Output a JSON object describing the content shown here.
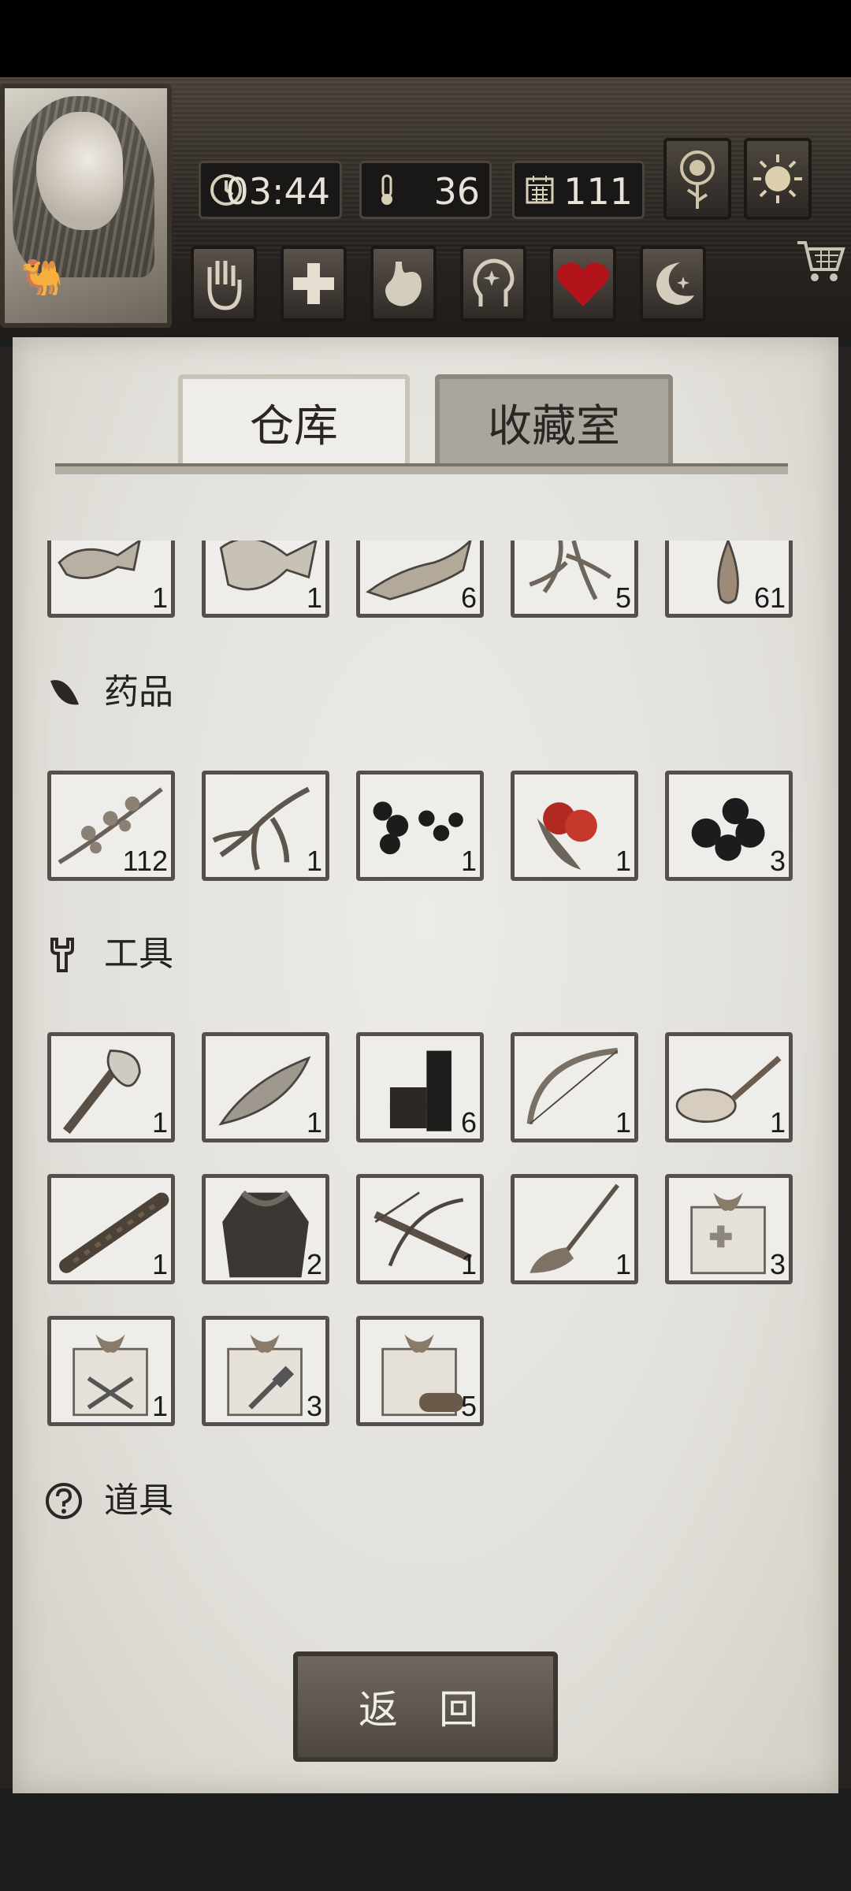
{
  "hud": {
    "time": "03:44",
    "temperature": "36",
    "days": "111",
    "stats_icons": [
      "clock-icon",
      "thermometer-icon",
      "calendar-icon"
    ],
    "status_icons": [
      "hand-icon",
      "cross-icon",
      "stomach-icon",
      "mind-icon",
      "heart-icon",
      "moon-icon"
    ],
    "top_right_icons": [
      "sunflower-icon",
      "sun-icon",
      "cart-icon"
    ],
    "heart_color": "#b3141b"
  },
  "tabs": {
    "warehouse": "仓库",
    "collection": "收藏室",
    "active": "warehouse"
  },
  "partial_row": [
    {
      "name": "fish-item",
      "qty": "1"
    },
    {
      "name": "flatfish-item",
      "qty": "1"
    },
    {
      "name": "eel-fish-item",
      "qty": "6"
    },
    {
      "name": "root-item",
      "qty": "5"
    },
    {
      "name": "drop-item",
      "qty": "61"
    }
  ],
  "sections": {
    "medicine": {
      "title": "药品",
      "items": [
        {
          "name": "herb-branch-item",
          "qty": "112"
        },
        {
          "name": "ginseng-item",
          "qty": "1"
        },
        {
          "name": "black-pills-item",
          "qty": "1"
        },
        {
          "name": "red-berries-item",
          "qty": "1"
        },
        {
          "name": "dark-berries-item",
          "qty": "3"
        }
      ]
    },
    "tools": {
      "title": "工具",
      "items": [
        {
          "name": "stone-axe-item",
          "qty": "1"
        },
        {
          "name": "stone-blade-item",
          "qty": "1"
        },
        {
          "name": "firecracker-item",
          "qty": "6"
        },
        {
          "name": "bow-item",
          "qty": "1"
        },
        {
          "name": "wooden-spoon-item",
          "qty": "1"
        },
        {
          "name": "torch-item",
          "qty": "1"
        },
        {
          "name": "fur-coat-item",
          "qty": "2"
        },
        {
          "name": "crossbow-item",
          "qty": "1"
        },
        {
          "name": "broom-item",
          "qty": "1"
        },
        {
          "name": "medical-gift-box-item",
          "qty": "3"
        },
        {
          "name": "tool-gift-box-item",
          "qty": "1"
        },
        {
          "name": "hammer-gift-box-item",
          "qty": "3"
        },
        {
          "name": "wood-gift-box-item",
          "qty": "5"
        }
      ]
    },
    "props": {
      "title": "道具"
    }
  },
  "back_button": "返 回"
}
